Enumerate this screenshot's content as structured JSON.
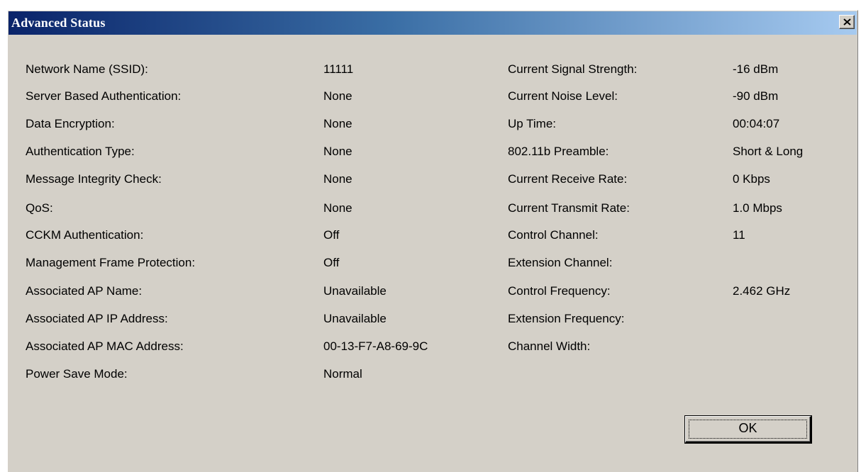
{
  "window": {
    "title": "Advanced Status",
    "close_symbol": "×"
  },
  "left_rows": [
    {
      "label": "Network Name (SSID):",
      "value": "11111"
    },
    {
      "label": "Server Based Authentication:",
      "value": "None"
    },
    {
      "label": "Data Encryption:",
      "value": "None"
    },
    {
      "label": "Authentication Type:",
      "value": "None"
    },
    {
      "label": "Message Integrity Check:",
      "value": "None"
    },
    {
      "label": "QoS:",
      "value": "None"
    },
    {
      "label": "CCKM Authentication:",
      "value": "Off"
    },
    {
      "label": "Management Frame Protection:",
      "value": "Off"
    },
    {
      "label": "Associated AP Name:",
      "value": "Unavailable"
    },
    {
      "label": "Associated AP IP Address:",
      "value": "Unavailable"
    },
    {
      "label": "Associated AP MAC Address:",
      "value": "00-13-F7-A8-69-9C"
    },
    {
      "label": "Power Save Mode:",
      "value": "Normal"
    }
  ],
  "right_rows": [
    {
      "label": "Current Signal Strength:",
      "value": "-16 dBm"
    },
    {
      "label": "Current Noise Level:",
      "value": "-90 dBm"
    },
    {
      "label": "Up Time:",
      "value": "00:04:07"
    },
    {
      "label": "802.11b Preamble:",
      "value": "Short & Long"
    },
    {
      "label": "Current Receive Rate:",
      "value": "0 Kbps"
    },
    {
      "label": "Current Transmit Rate:",
      "value": "1.0 Mbps"
    },
    {
      "label": "Control Channel:",
      "value": "11"
    },
    {
      "label": "Extension Channel:",
      "value": ""
    },
    {
      "label": "Control Frequency:",
      "value": "2.462 GHz"
    },
    {
      "label": "Extension Frequency:",
      "value": ""
    },
    {
      "label": "Channel Width:",
      "value": ""
    }
  ],
  "buttons": {
    "ok_label": "OK"
  },
  "colors": {
    "dialog_face": "#d4d0c8",
    "title_gradient_start": "#0a246a",
    "title_gradient_end": "#a6caf0",
    "title_text": "#ffffff"
  },
  "icons": {
    "close": "close-icon"
  }
}
